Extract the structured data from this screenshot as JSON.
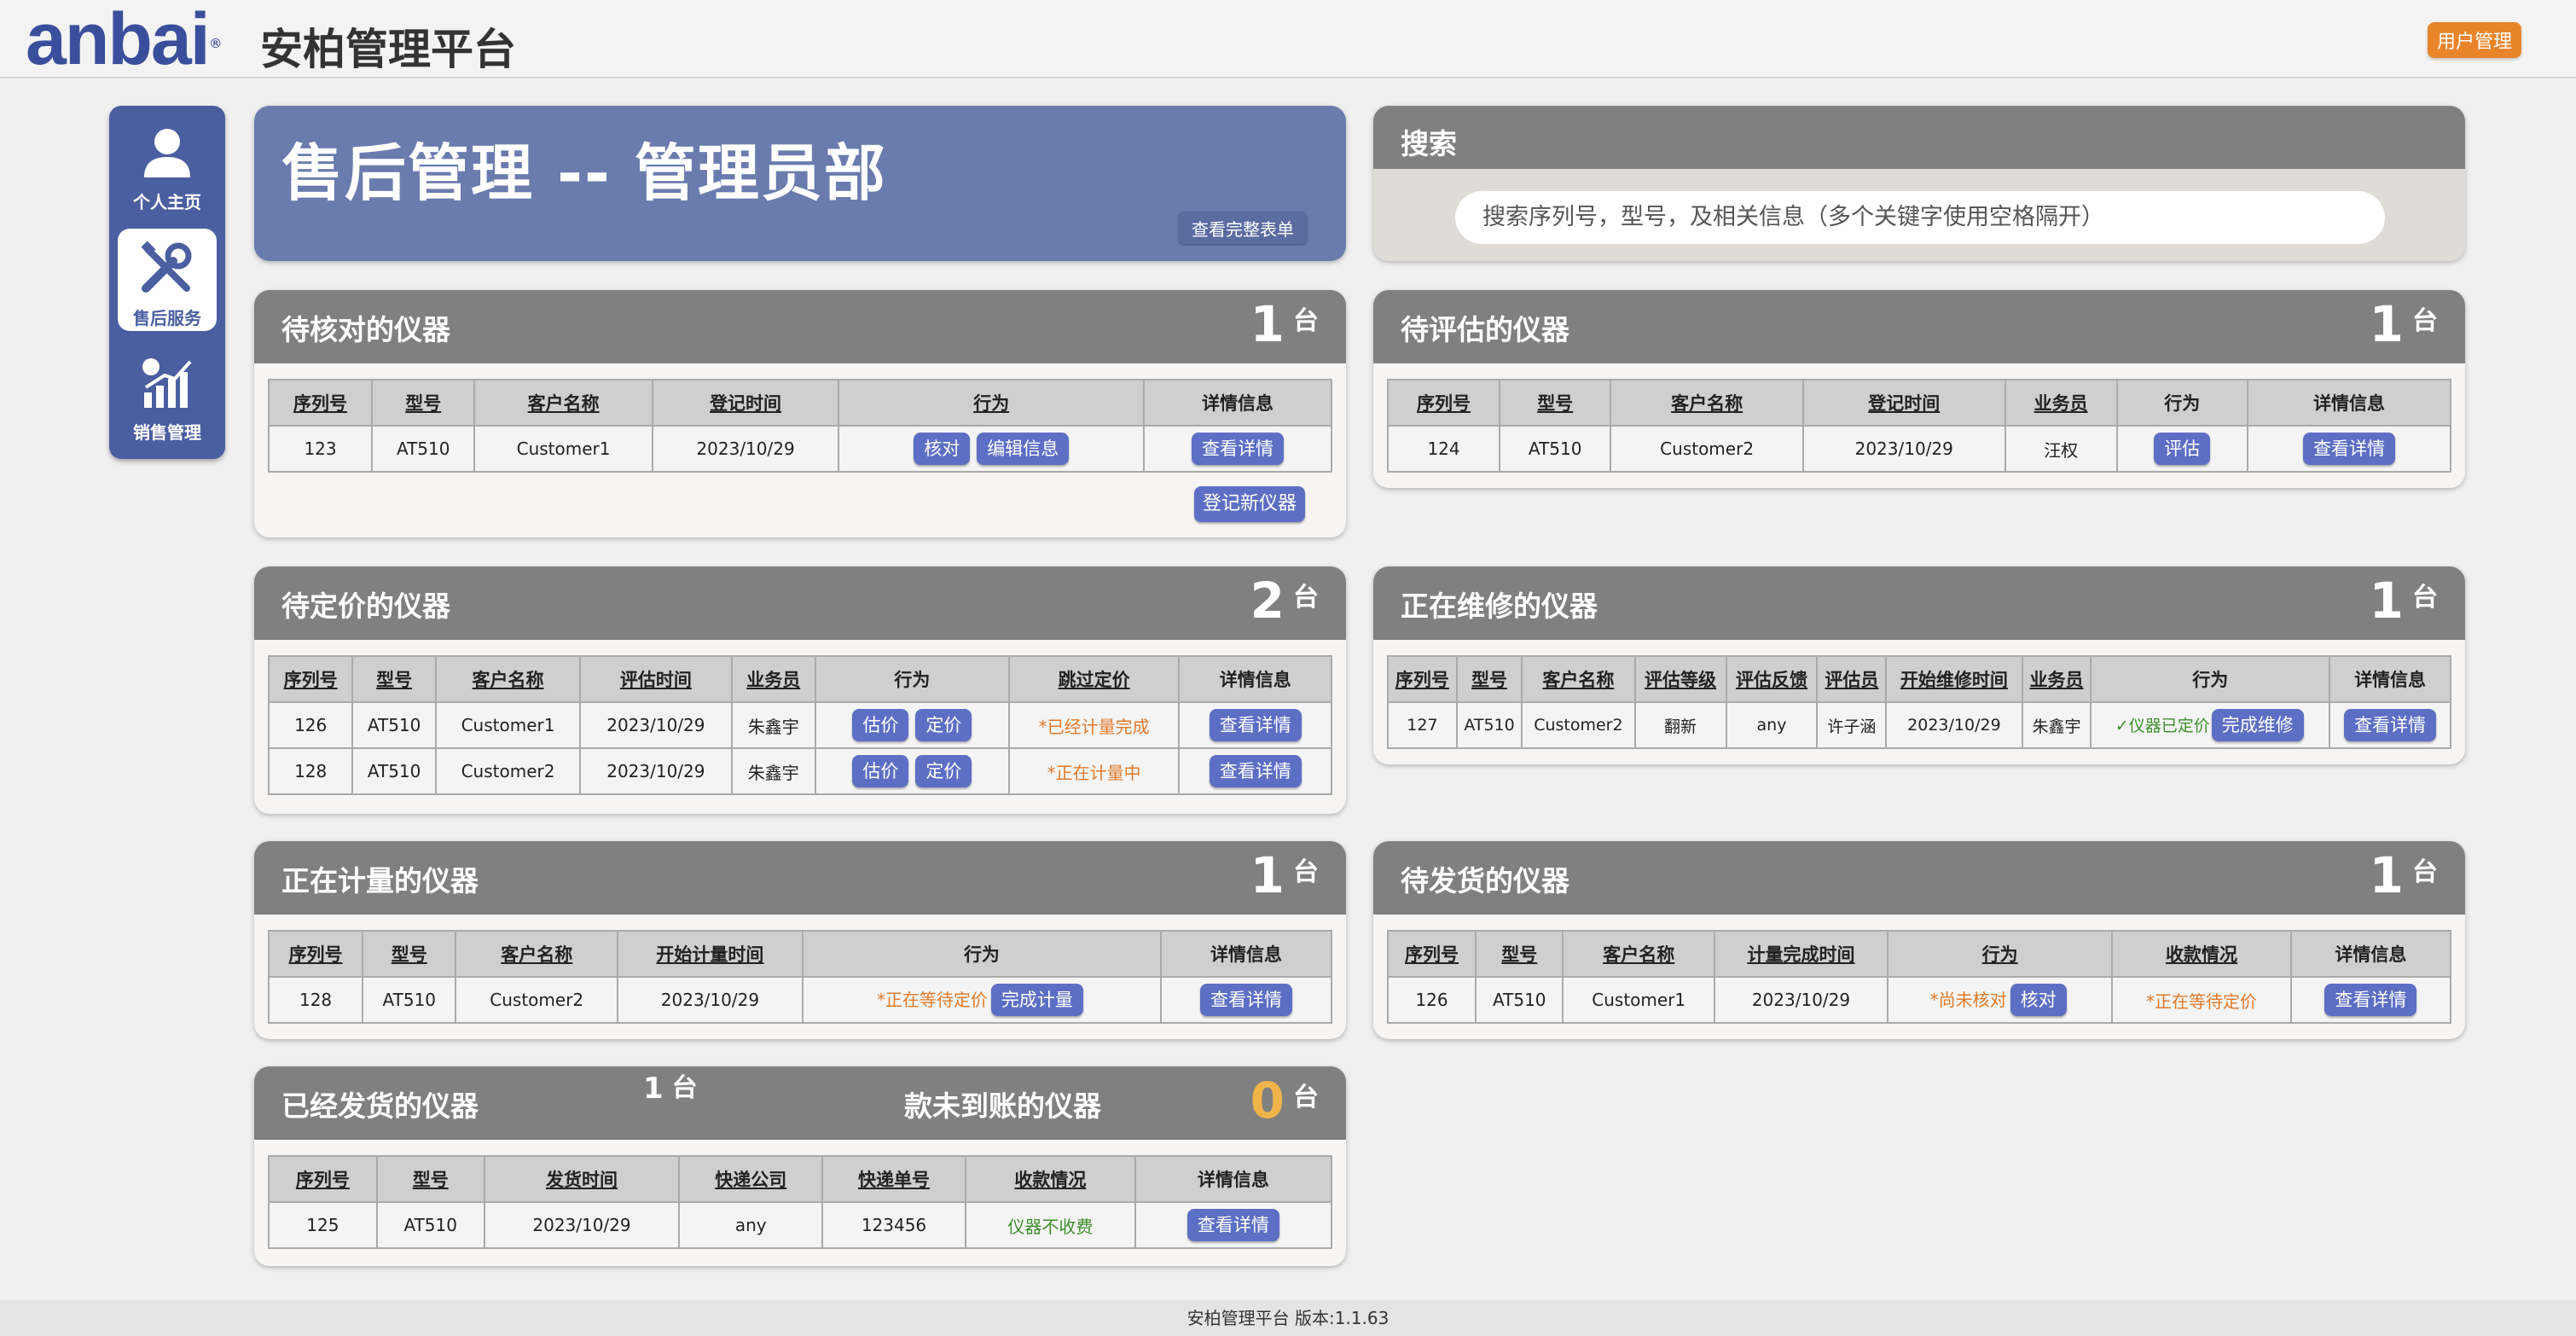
{
  "brand": {
    "logo": "anbai",
    "reg": "®",
    "title": "安柏管理平台",
    "user_button": "用户管理"
  },
  "sidebar": {
    "items": [
      {
        "label": "个人主页",
        "icon": "user-icon"
      },
      {
        "label": "售后服务",
        "icon": "tools-icon"
      },
      {
        "label": "销售管理",
        "icon": "sales-chart-icon"
      }
    ]
  },
  "hero": {
    "title": "售后管理 -- 管理员部",
    "button": "查看完整表单"
  },
  "search": {
    "title": "搜索",
    "placeholder": "搜索序列号，型号，及相关信息（多个关键字使用空格隔开）"
  },
  "unit": "台",
  "pending_check": {
    "title": "待核对的仪器",
    "count": "1",
    "headers": [
      "序列号",
      "型号",
      "客户名称",
      "登记时间",
      "行为",
      "详情信息"
    ],
    "rows": [
      {
        "serial": "123",
        "model": "AT510",
        "customer": "Customer1",
        "time": "2023/10/29",
        "a1": "核对",
        "a2": "编辑信息",
        "detail": "查看详情"
      }
    ],
    "register": "登记新仪器"
  },
  "pending_eval": {
    "title": "待评估的仪器",
    "count": "1",
    "headers": [
      "序列号",
      "型号",
      "客户名称",
      "登记时间",
      "业务员",
      "行为",
      "详情信息"
    ],
    "rows": [
      {
        "serial": "124",
        "model": "AT510",
        "customer": "Customer2",
        "time": "2023/10/29",
        "staff": "汪权",
        "a1": "评估",
        "detail": "查看详情"
      }
    ]
  },
  "pending_price": {
    "title": "待定价的仪器",
    "count": "2",
    "headers": [
      "序列号",
      "型号",
      "客户名称",
      "评估时间",
      "业务员",
      "行为",
      "跳过定价",
      "详情信息"
    ],
    "rows": [
      {
        "serial": "126",
        "model": "AT510",
        "customer": "Customer1",
        "time": "2023/10/29",
        "staff": "朱鑫宇",
        "a1": "估价",
        "a2": "定价",
        "skip": "*已经计量完成",
        "detail": "查看详情"
      },
      {
        "serial": "128",
        "model": "AT510",
        "customer": "Customer2",
        "time": "2023/10/29",
        "staff": "朱鑫宇",
        "a1": "估价",
        "a2": "定价",
        "skip": "*正在计量中",
        "detail": "查看详情"
      }
    ]
  },
  "repairing": {
    "title": "正在维修的仪器",
    "count": "1",
    "headers": [
      "序列号",
      "型号",
      "客户名称",
      "评估等级",
      "评估反馈",
      "评估员",
      "开始维修时间",
      "业务员",
      "行为",
      "详情信息"
    ],
    "rows": [
      {
        "serial": "127",
        "model": "AT510",
        "customer": "Customer2",
        "level": "翻新",
        "feedback": "any",
        "evaluator": "许子涵",
        "time": "2023/10/29",
        "staff": "朱鑫宇",
        "status": "✓仪器已定价",
        "a1": "完成维修",
        "detail": "查看详情"
      }
    ]
  },
  "measuring": {
    "title": "正在计量的仪器",
    "count": "1",
    "headers": [
      "序列号",
      "型号",
      "客户名称",
      "开始计量时间",
      "行为",
      "详情信息"
    ],
    "rows": [
      {
        "serial": "128",
        "model": "AT510",
        "customer": "Customer2",
        "time": "2023/10/29",
        "status": "*正在等待定价",
        "a1": "完成计量",
        "detail": "查看详情"
      }
    ]
  },
  "pending_ship": {
    "title": "待发货的仪器",
    "count": "1",
    "headers": [
      "序列号",
      "型号",
      "客户名称",
      "计量完成时间",
      "行为",
      "收款情况",
      "详情信息"
    ],
    "rows": [
      {
        "serial": "126",
        "model": "AT510",
        "customer": "Customer1",
        "time": "2023/10/29",
        "status": "*尚未核对",
        "a1": "核对",
        "payment": "*正在等待定价",
        "detail": "查看详情"
      }
    ]
  },
  "shipped": {
    "title": "已经发货的仪器",
    "count": "1",
    "unpaid_title": "款未到账的仪器",
    "unpaid_count": "0",
    "headers": [
      "序列号",
      "型号",
      "发货时间",
      "快递公司",
      "快递单号",
      "收款情况",
      "详情信息"
    ],
    "rows": [
      {
        "serial": "125",
        "model": "AT510",
        "time": "2023/10/29",
        "courier": "any",
        "tracking": "123456",
        "payment": "仪器不收费",
        "detail": "查看详情"
      }
    ]
  },
  "colors": {
    "brand": "#3a4f9c",
    "hero": "#6a7bae",
    "button": "#5d6fc4",
    "header": "#808080",
    "orange": "#e8852b",
    "unpaid_count": "#f0b44a"
  },
  "footer": {
    "text": "安柏管理平台   版本:1.1.63"
  }
}
